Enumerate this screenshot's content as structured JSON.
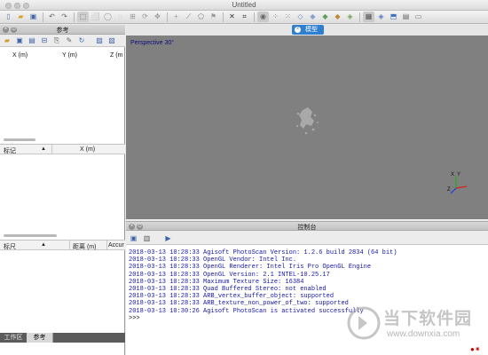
{
  "window": {
    "title": "Untitled"
  },
  "toolbar": {
    "icons": [
      "new-document-icon",
      "open-folder-icon",
      "save-icon",
      "undo-icon",
      "redo-icon",
      "navigation-icon",
      "rectangle-select-icon",
      "circle-select-icon",
      "free-select-icon",
      "resize-region-icon",
      "rotate-region-icon",
      "move-object-icon",
      "rotate-object-icon",
      "ruler-icon",
      "delete-icon",
      "crop-icon",
      "photo-icon",
      "point-cloud-icon",
      "dense-cloud-icon",
      "wireframe-icon",
      "shaded-icon",
      "solid-icon",
      "textured-icon",
      "tiled-model-icon",
      "dem-icon",
      "cameras-icon",
      "shapes-icon",
      "markers-icon",
      "orthomosaic-icon"
    ]
  },
  "reference_panel": {
    "title": "参考",
    "columns": [
      "X (m)",
      "Y (m)",
      "Z (m"
    ],
    "markers": {
      "label_col": "标记",
      "sort_indicator": "▲",
      "x_col": "X (m)"
    },
    "scale_bars": {
      "label_col": "标尺",
      "sort_indicator": "▲",
      "distance_col": "距离 (m)",
      "accuracy_col": "Accur"
    }
  },
  "bottom_tabs": [
    {
      "label": "工作区",
      "active": false
    },
    {
      "label": "参考",
      "active": true
    }
  ],
  "viewport": {
    "tab_label": "模型",
    "projection_label": "Perspective 30°",
    "axis_labels": {
      "x": "X",
      "y": "Y",
      "z": "Z"
    },
    "axis_colors": {
      "x": "#d82020",
      "y": "#20b020",
      "z": "#2040e0"
    }
  },
  "console": {
    "title": "控制台",
    "lines": [
      "2018-03-13 10:28:33 Agisoft PhotoScan Version: 1.2.6 build 2834 (64 bit)",
      "2018-03-13 10:28:33 OpenGL Vendor: Intel Inc.",
      "2018-03-13 10:28:33 OpenGL Renderer: Intel Iris Pro OpenGL Engine",
      "2018-03-13 10:28:33 OpenGL Version: 2.1 INTEL-10.25.17",
      "2018-03-13 10:28:33 Maximum Texture Size: 16384",
      "2018-03-13 10:28:33 Quad Buffered Stereo: not enabled",
      "2018-03-13 10:28:33 ARB_vertex_buffer_object: supported",
      "2018-03-13 10:28:33 ARB_texture_non_power_of_two: supported",
      "2018-03-13 10:30:26 Agisoft PhotoScan is activated successfully"
    ],
    "prompt": ">>>"
  },
  "watermark": {
    "text": "当下软件园",
    "url": "www.downxia.com"
  }
}
